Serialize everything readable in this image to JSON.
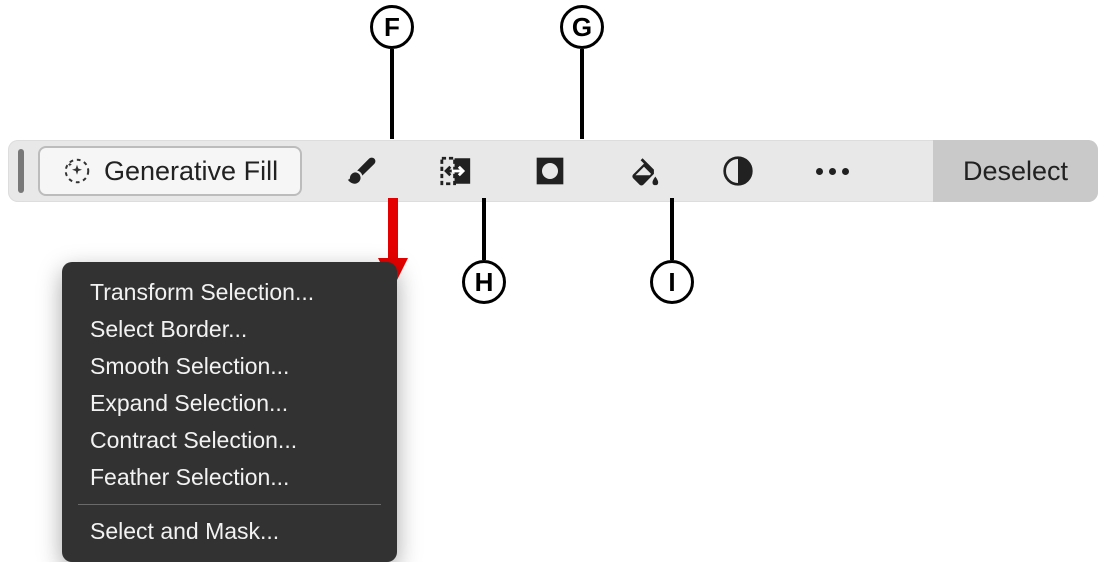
{
  "toolbar": {
    "generative_fill_label": "Generative Fill",
    "deselect_label": "Deselect",
    "icons": {
      "brush": "brush-icon",
      "transform": "transform-selection-icon",
      "mask": "mask-icon",
      "fill": "paint-bucket-icon",
      "adjust": "adjustment-icon",
      "more": "more-icon"
    }
  },
  "callouts": {
    "f": "F",
    "g": "G",
    "h": "H",
    "i": "I"
  },
  "menu": {
    "items": [
      "Transform Selection...",
      "Select Border...",
      "Smooth Selection...",
      "Expand Selection...",
      "Contract Selection...",
      "Feather Selection..."
    ],
    "footer": "Select and Mask..."
  }
}
